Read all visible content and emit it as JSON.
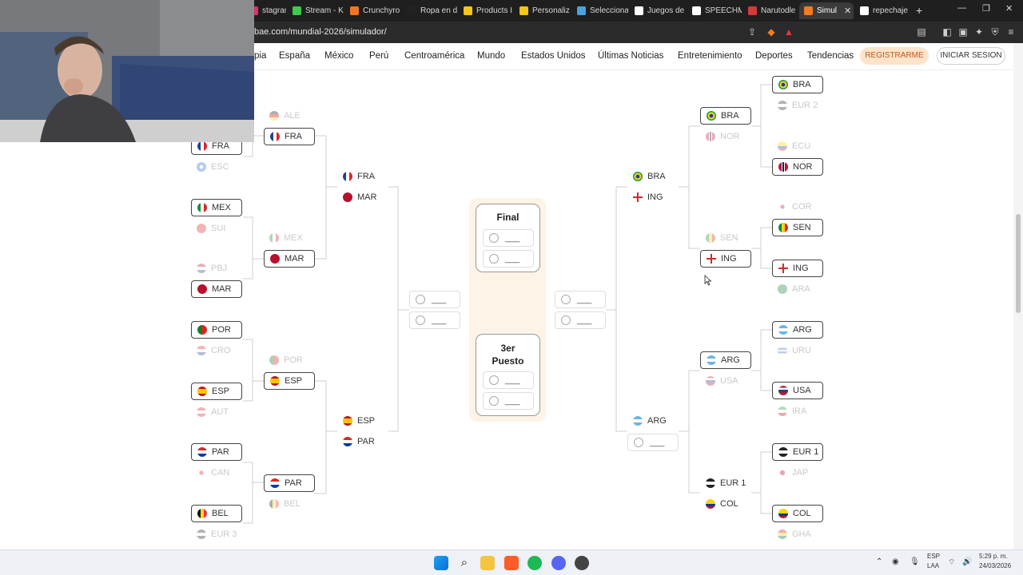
{
  "browser": {
    "tabs": [
      {
        "label": "stagram",
        "color": "#e1306c"
      },
      {
        "label": "Stream - K",
        "color": "#3ec94f"
      },
      {
        "label": "Crunchyro",
        "color": "#f47521"
      },
      {
        "label": "Ropa en d",
        "color": "#222222"
      },
      {
        "label": "Products I",
        "color": "#f5c518"
      },
      {
        "label": "Personaliz",
        "color": "#f5c518"
      },
      {
        "label": "Selecciona",
        "color": "#4aa3df"
      },
      {
        "label": "Juegos de",
        "color": "#ffffff"
      },
      {
        "label": "SPEECHM",
        "color": "#ffffff"
      },
      {
        "label": "Narutodle",
        "color": "#d33b3b"
      },
      {
        "label": "Simul",
        "color": "#f47b20"
      },
      {
        "label": "repechaje",
        "color": "#ffffff"
      }
    ],
    "url": "bae.com/mundial-2026/simulador/"
  },
  "nav": {
    "items": [
      "pia",
      "España",
      "México",
      "Perú",
      "Centroamérica",
      "Mundo",
      "Estados Unidos",
      "Últimas Noticias",
      "Entretenimiento",
      "Deportes",
      "Tendencias"
    ],
    "register": "REGISTRARME",
    "login": "INICIAR SESION"
  },
  "bracket": {
    "final_title": "Final",
    "third_title": "3er\nPuesto",
    "empty_slot": "___",
    "left_r32": [
      {
        "code": "FRA",
        "state": "sel",
        "flag": "fr"
      },
      {
        "code": "ESC",
        "state": "dim",
        "flag": "sc"
      },
      {
        "code": "MEX",
        "state": "sel",
        "flag": "mx"
      },
      {
        "code": "SUI",
        "state": "dim",
        "flag": "ch"
      },
      {
        "code": "PBJ",
        "state": "dim",
        "flag": "nl"
      },
      {
        "code": "MAR",
        "state": "sel",
        "flag": "ma"
      },
      {
        "code": "POR",
        "state": "sel",
        "flag": "pt"
      },
      {
        "code": "CRO",
        "state": "dim",
        "flag": "hr"
      },
      {
        "code": "ESP",
        "state": "sel",
        "flag": "es"
      },
      {
        "code": "AUT",
        "state": "dim",
        "flag": "at"
      },
      {
        "code": "PAR",
        "state": "sel",
        "flag": "py"
      },
      {
        "code": "CAN",
        "state": "dim",
        "flag": "ca"
      },
      {
        "code": "BEL",
        "state": "sel",
        "flag": "be"
      },
      {
        "code": "EUR 3",
        "state": "dim",
        "flag": "eu"
      }
    ],
    "left_r16": [
      {
        "code": "ALE",
        "state": "dim",
        "flag": "de"
      },
      {
        "code": "FRA",
        "state": "sel",
        "flag": "fr"
      },
      {
        "code": "MEX",
        "state": "dim",
        "flag": "mx"
      },
      {
        "code": "MAR",
        "state": "sel",
        "flag": "ma"
      },
      {
        "code": "POR",
        "state": "dim",
        "flag": "pt"
      },
      {
        "code": "ESP",
        "state": "sel",
        "flag": "es"
      },
      {
        "code": "PAR",
        "state": "sel",
        "flag": "py"
      },
      {
        "code": "BEL",
        "state": "dim",
        "flag": "be"
      }
    ],
    "left_qf": [
      {
        "code": "FRA",
        "state": "",
        "flag": "fr"
      },
      {
        "code": "MAR",
        "state": "",
        "flag": "ma"
      },
      {
        "code": "ESP",
        "state": "",
        "flag": "es"
      },
      {
        "code": "PAR",
        "state": "",
        "flag": "py"
      }
    ],
    "right_r32": [
      {
        "code": "BRA",
        "state": "sel",
        "flag": "br"
      },
      {
        "code": "EUR 2",
        "state": "dim",
        "flag": "eu"
      },
      {
        "code": "ECU",
        "state": "dim",
        "flag": "ec"
      },
      {
        "code": "NOR",
        "state": "sel",
        "flag": "no"
      },
      {
        "code": "COR",
        "state": "dim",
        "flag": "kr"
      },
      {
        "code": "SEN",
        "state": "sel",
        "flag": "sn"
      },
      {
        "code": "ING",
        "state": "sel",
        "flag": "en"
      },
      {
        "code": "ARA",
        "state": "dim",
        "flag": "sa"
      },
      {
        "code": "ARG",
        "state": "sel",
        "flag": "ar"
      },
      {
        "code": "URU",
        "state": "dim",
        "flag": "uy"
      },
      {
        "code": "USA",
        "state": "sel",
        "flag": "us"
      },
      {
        "code": "IRA",
        "state": "dim",
        "flag": "ir"
      },
      {
        "code": "EUR 1",
        "state": "sel",
        "flag": "eu"
      },
      {
        "code": "JAP",
        "state": "dim",
        "flag": "jp"
      },
      {
        "code": "COL",
        "state": "sel",
        "flag": "co"
      },
      {
        "code": "GHA",
        "state": "dim",
        "flag": "gh"
      }
    ],
    "right_r16": [
      {
        "code": "BRA",
        "state": "sel",
        "flag": "br"
      },
      {
        "code": "NOR",
        "state": "dim",
        "flag": "no"
      },
      {
        "code": "SEN",
        "state": "dim",
        "flag": "sn"
      },
      {
        "code": "ING",
        "state": "sel",
        "flag": "en"
      },
      {
        "code": "ARG",
        "state": "sel",
        "flag": "ar"
      },
      {
        "code": "USA",
        "state": "dim",
        "flag": "us"
      },
      {
        "code": "EUR 1",
        "state": "",
        "flag": "eu"
      },
      {
        "code": "COL",
        "state": "",
        "flag": "co"
      }
    ],
    "right_qf": [
      {
        "code": "BRA",
        "state": "",
        "flag": "br"
      },
      {
        "code": "ING",
        "state": "",
        "flag": "en"
      },
      {
        "code": "ARG",
        "state": "",
        "flag": "ar"
      }
    ]
  },
  "taskbar": {
    "lang": "ESP",
    "lang2": "LAA",
    "time": "5:29 p. m.",
    "date": "24/03/2026"
  },
  "colors": {
    "accent": "#f47b20",
    "register_bg": "#fde3c9",
    "center_bg": "#fdf3e6"
  }
}
